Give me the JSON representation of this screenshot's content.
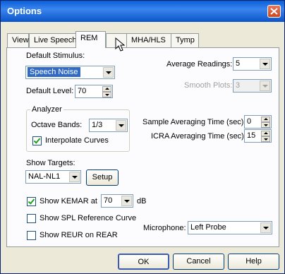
{
  "window": {
    "title": "Options"
  },
  "tabs": [
    {
      "label": "View"
    },
    {
      "label": "Live Speech"
    },
    {
      "label": "REM"
    },
    {
      "label": "MHA/HLS"
    },
    {
      "label": "Tymp"
    }
  ],
  "rem": {
    "default_stimulus_label": "Default Stimulus:",
    "default_stimulus_value": "Speech Noise",
    "default_level_label": "Default Level:",
    "default_level_value": "70",
    "average_readings_label": "Average Readings:",
    "average_readings_value": "5",
    "smooth_plots_label": "Smooth Plots:",
    "smooth_plots_value": "3",
    "analyzer_label": "Analyzer",
    "octave_bands_label": "Octave Bands:",
    "octave_bands_value": "1/3",
    "interpolate_label": "Interpolate Curves",
    "interpolate_checked": true,
    "sample_avg_label": "Sample Averaging Time (sec):",
    "sample_avg_value": "0",
    "icra_avg_label": "ICRA Averaging Time (sec):",
    "icra_avg_value": "15",
    "show_targets_label": "Show Targets:",
    "show_targets_value": "NAL-NL1",
    "setup_label": "Setup",
    "show_kemar_label": "Show KEMAR at",
    "show_kemar_checked": true,
    "kemar_value": "70",
    "kemar_unit": "dB",
    "show_spl_label": "Show SPL Reference Curve",
    "show_spl_checked": false,
    "show_reur_label": "Show REUR on REAR",
    "show_reur_checked": false,
    "microphone_label": "Microphone:",
    "microphone_value": "Left Probe"
  },
  "buttons": {
    "ok": "OK",
    "cancel": "Cancel",
    "help": "Help"
  }
}
